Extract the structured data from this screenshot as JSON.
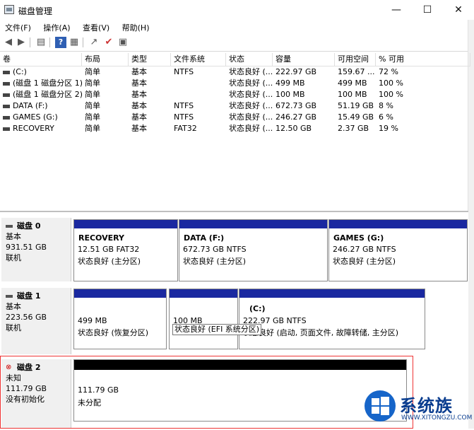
{
  "window": {
    "title": "磁盘管理",
    "minimize": "—",
    "maximize": "☐",
    "close": "✕"
  },
  "menu": [
    "文件(F)",
    "操作(A)",
    "查看(V)",
    "帮助(H)"
  ],
  "toolbar_icons": [
    "back-icon",
    "forward-icon",
    "properties-icon",
    "help-icon",
    "console-icon",
    "connect-icon",
    "checkmark-icon",
    "settings-icon"
  ],
  "volumes": {
    "headers": [
      "卷",
      "布局",
      "类型",
      "文件系统",
      "状态",
      "容量",
      "可用空间",
      "% 可用"
    ],
    "rows": [
      [
        "(C:)",
        "简单",
        "基本",
        "NTFS",
        "状态良好 (...",
        "222.97 GB",
        "159.67 ...",
        "72 %"
      ],
      [
        "(磁盘 1 磁盘分区 1)",
        "简单",
        "基本",
        "",
        "状态良好 (...",
        "499 MB",
        "499 MB",
        "100 %"
      ],
      [
        "(磁盘 1 磁盘分区 2)",
        "简单",
        "基本",
        "",
        "状态良好 (...",
        "100 MB",
        "100 MB",
        "100 %"
      ],
      [
        "DATA (F:)",
        "简单",
        "基本",
        "NTFS",
        "状态良好 (...",
        "672.73 GB",
        "51.19 GB",
        "8 %"
      ],
      [
        "GAMES (G:)",
        "简单",
        "基本",
        "NTFS",
        "状态良好 (...",
        "246.27 GB",
        "15.49 GB",
        "6 %"
      ],
      [
        "RECOVERY",
        "简单",
        "基本",
        "FAT32",
        "状态良好 (...",
        "12.50 GB",
        "2.37 GB",
        "19 %"
      ]
    ]
  },
  "disks": {
    "disk0": {
      "name": "磁盘 0",
      "type": "基本",
      "size": "931.51 GB",
      "status": "联机",
      "partitions": [
        {
          "name": "RECOVERY",
          "size": "12.51 GB FAT32",
          "state": "状态良好 (主分区)"
        },
        {
          "name": "DATA  (F:)",
          "size": "672.73 GB NTFS",
          "state": "状态良好 (主分区)"
        },
        {
          "name": "GAMES  (G:)",
          "size": "246.27 GB NTFS",
          "state": "状态良好 (主分区)"
        }
      ]
    },
    "disk1": {
      "name": "磁盘 1",
      "type": "基本",
      "size": "223.56 GB",
      "status": "联机",
      "partitions": [
        {
          "size": "499 MB",
          "state": "状态良好 (恢复分区)"
        },
        {
          "size": "100 MB",
          "state": "状态良好 (EFI 系统分区)"
        },
        {
          "name": "(C:)",
          "size": "222.97 GB NTFS",
          "state": "状态良好 (启动, 页面文件, 故障转储, 主分区)"
        }
      ]
    },
    "disk2": {
      "name": "磁盘 2",
      "type": "未知",
      "size": "111.79 GB",
      "status": "没有初始化",
      "partition": {
        "size": "111.79 GB",
        "state": "未分配"
      }
    }
  },
  "watermark": {
    "text": "系统族",
    "sub": "WWW.XITONGZU.COM"
  },
  "colors": {
    "primary_partition": "#1a28a0",
    "unallocated": "#000000",
    "highlight": "#e33333"
  }
}
